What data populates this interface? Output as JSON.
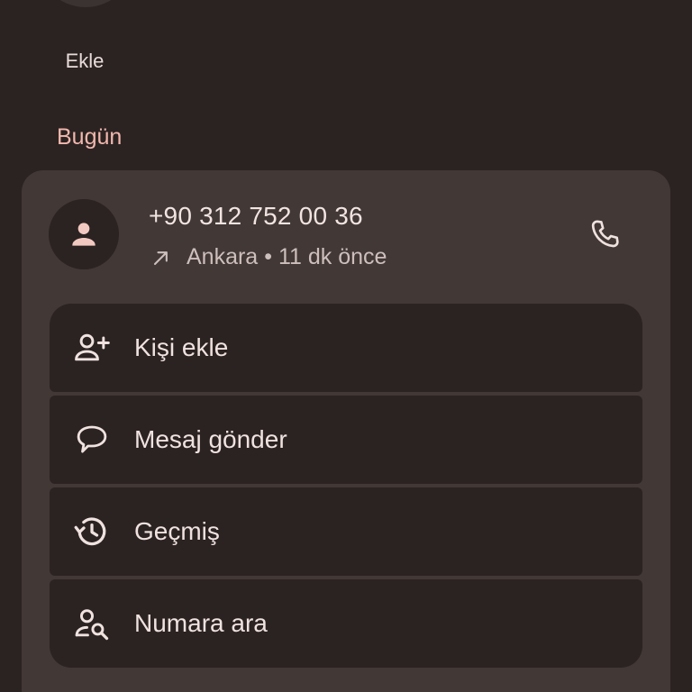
{
  "favorites": {
    "add_label": "Ekle"
  },
  "section": {
    "title": "Bugün"
  },
  "call_entry": {
    "number": "+90 312 752 00 36",
    "location": "Ankara",
    "separator": "•",
    "time_ago": "11 dk önce",
    "direction_icon": "outgoing-arrow-icon"
  },
  "actions": [
    {
      "label": "Kişi ekle",
      "icon": "person-add-icon"
    },
    {
      "label": "Mesaj gönder",
      "icon": "message-icon"
    },
    {
      "label": "Geçmiş",
      "icon": "history-icon"
    },
    {
      "label": "Numara ara",
      "icon": "person-search-icon"
    }
  ],
  "colors": {
    "background": "#2b2322",
    "card": "#423836",
    "accent": "#f2b8ae",
    "text": "#efe2df"
  }
}
